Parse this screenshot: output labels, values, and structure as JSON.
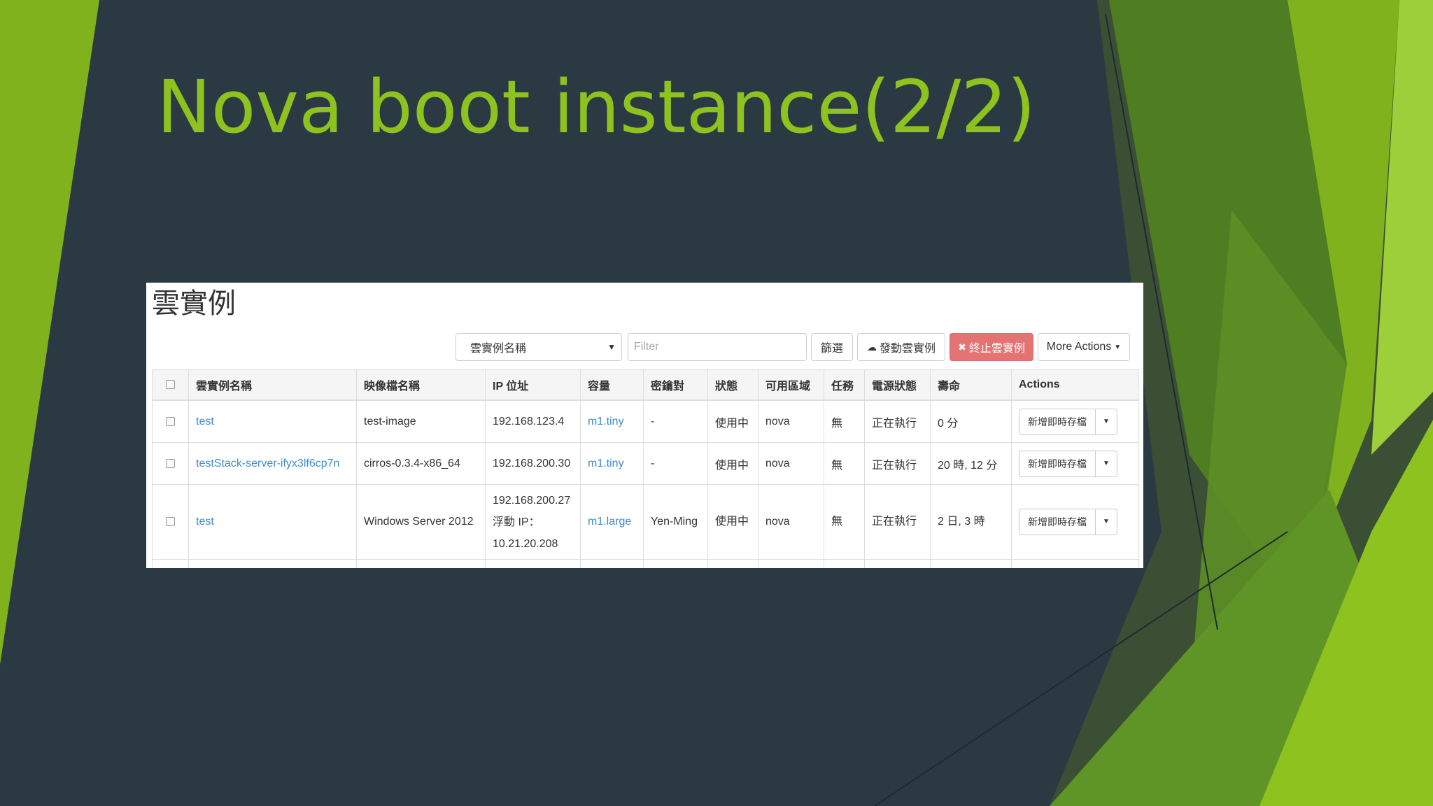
{
  "slide": {
    "title": "Nova boot instance(2/2)",
    "colors": {
      "background": "#2b3a42",
      "title": "#8dc21f",
      "accent_green": "#7fb21d",
      "dark_green": "#4f7d22"
    }
  },
  "screenshot": {
    "heading": "雲實例",
    "toolbar": {
      "select_value": "雲實例名稱",
      "filter_placeholder": "Filter",
      "filter_button": "篩選",
      "launch_button": "發動雲實例",
      "launch_icon": "cloud-upload-icon",
      "terminate_button": "終止雲實例",
      "terminate_icon": "close-icon",
      "more_actions": "More Actions"
    },
    "columns": [
      "雲實例名稱",
      "映像檔名稱",
      "IP 位址",
      "容量",
      "密鑰對",
      "狀態",
      "可用區域",
      "任務",
      "電源狀態",
      "壽命",
      "Actions"
    ],
    "rows": [
      {
        "name": "test",
        "image": "test-image",
        "ip": [
          "192.168.123.4"
        ],
        "size": "m1.tiny",
        "keypair": "-",
        "status": "使用中",
        "zone": "nova",
        "task": "無",
        "power": "正在執行",
        "age": "0 分",
        "action": "新增即時存檔"
      },
      {
        "name": "testStack-server-ifyx3lf6cp7n",
        "image": "cirros-0.3.4-x86_64",
        "ip": [
          "192.168.200.30"
        ],
        "size": "m1.tiny",
        "keypair": "-",
        "status": "使用中",
        "zone": "nova",
        "task": "無",
        "power": "正在執行",
        "age": "20 時, 12 分",
        "action": "新增即時存檔"
      },
      {
        "name": "test",
        "image": "Windows Server 2012",
        "ip": [
          "192.168.200.27",
          "浮動 IP：",
          "10.21.20.208"
        ],
        "size": "m1.large",
        "keypair": "Yen-Ming",
        "status": "使用中",
        "zone": "nova",
        "task": "無",
        "power": "正在執行",
        "age": "2 日, 3 時",
        "action": "新增即時存檔"
      }
    ]
  }
}
